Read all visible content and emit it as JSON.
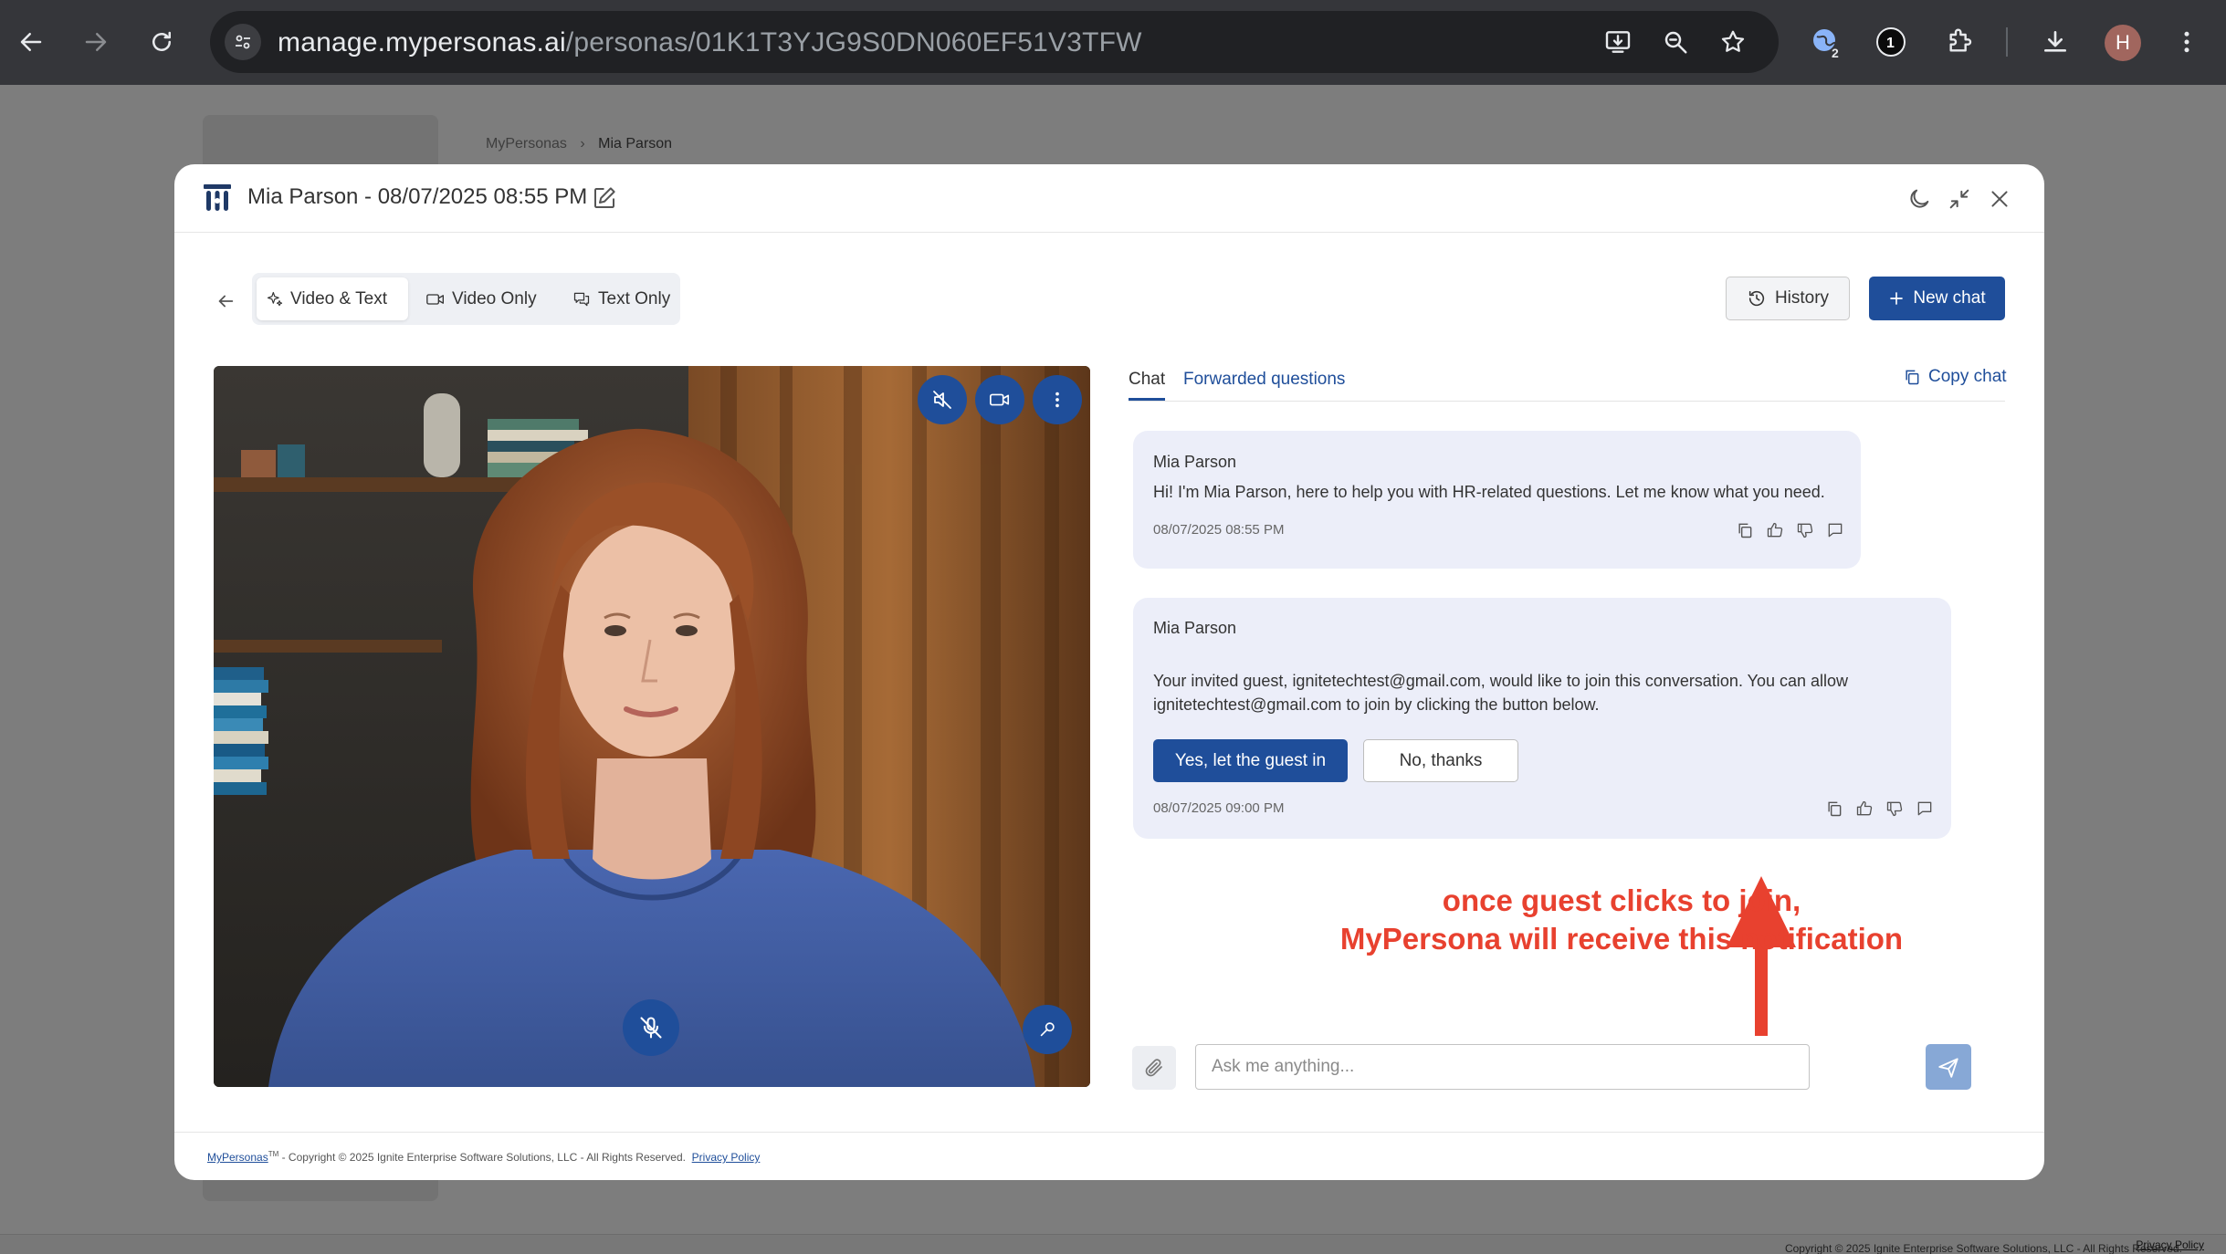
{
  "browser": {
    "url_host": "manage.mypersonas.ai",
    "url_path": "/personas/01K1T3YJG9S0DN060EF51V3TFW",
    "ext_badge_count": "2",
    "ext_badge_one": "1",
    "profile_initial": "H"
  },
  "background": {
    "breadcrumb_root": "MyPersonas",
    "breadcrumb_current": "Mia Parson",
    "footer_copyright": "Copyright © 2025 Ignite Enterprise Software Solutions, LLC - All Rights Reserved.",
    "footer_privacy": "Privacy Policy"
  },
  "modal": {
    "title": "Mia Parson - 08/07/2025 08:55 PM",
    "modes": [
      {
        "label": "Video & Text",
        "active": true
      },
      {
        "label": "Video Only",
        "active": false
      },
      {
        "label": "Text Only",
        "active": false
      }
    ],
    "history_label": "History",
    "new_chat_label": "New chat"
  },
  "chat": {
    "tabs": [
      {
        "label": "Chat",
        "active": true
      },
      {
        "label": "Forwarded questions",
        "active": false
      }
    ],
    "copy_label": "Copy chat",
    "messages": [
      {
        "sender": "Mia Parson",
        "text": "Hi! I'm Mia Parson, here to help you with HR-related questions. Let me know what you need.",
        "time": "08/07/2025 08:55 PM"
      },
      {
        "sender": "Mia Parson",
        "text": "Your invited guest, ignitetechtest@gmail.com, would like to join this conversation. You can allow ignitetechtest@gmail.com to join by clicking the button below.",
        "time": "08/07/2025 09:00 PM",
        "accept_label": "Yes, let the guest in",
        "decline_label": "No, thanks"
      }
    ],
    "input_placeholder": "Ask me anything..."
  },
  "annotation": {
    "line1": "once guest clicks to join,",
    "line2": "MyPersona will receive this notification"
  },
  "footer": {
    "brand": "MyPersonas",
    "trademark": "TM",
    "copyright": " - Copyright © 2025 Ignite Enterprise Software Solutions, LLC - All Rights Reserved.",
    "privacy": "Privacy Policy"
  },
  "colors": {
    "primary": "#1f4e9a",
    "bubble": "#eceef9",
    "annotation": "#e8412f"
  }
}
